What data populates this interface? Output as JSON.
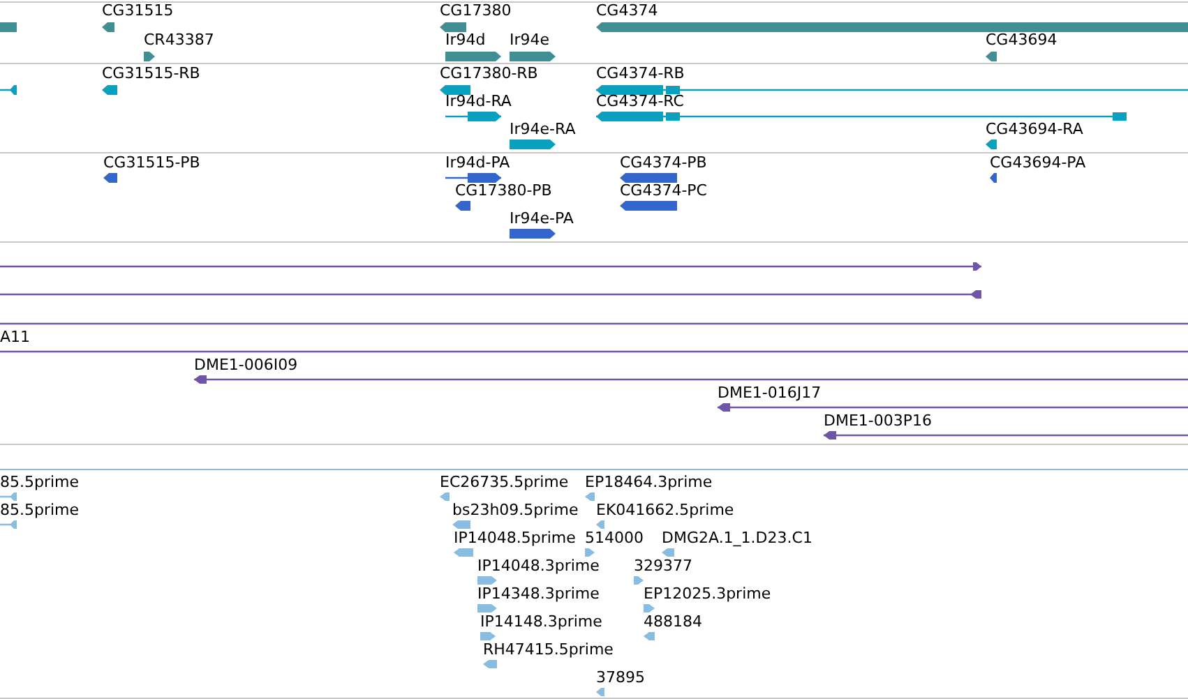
{
  "tracks": [
    {
      "features": [
        {
          "reverse": true
        },
        {
          "label": "CG31515",
          "reverse": true
        },
        {
          "label": "CR43387",
          "reverse": false
        },
        {
          "label": "CG17380",
          "reverse": true
        },
        {
          "label": "Ir94d",
          "reverse": false
        },
        {
          "label": "Ir94e",
          "reverse": false
        },
        {
          "label": "CG4374",
          "reverse": true
        },
        {
          "label": "CG43694",
          "reverse": true
        }
      ]
    },
    {
      "features": [
        {
          "reverse": true
        },
        {
          "label": "CG31515-RB",
          "reverse": true
        },
        {
          "label": "CG17380-RB",
          "reverse": true
        },
        {
          "label": "Ir94d-RA",
          "reverse": false
        },
        {
          "label": "Ir94e-RA",
          "reverse": false
        },
        {
          "label": "CG4374-RB",
          "reverse": true
        },
        {
          "label": "CG4374-RC",
          "reverse": true
        },
        {
          "label": "CG43694-RA",
          "reverse": true
        }
      ]
    },
    {
      "features": [
        {
          "label": "CG31515-PB",
          "reverse": true
        },
        {
          "label": "Ir94d-PA",
          "reverse": false
        },
        {
          "label": "CG17380-PB",
          "reverse": true
        },
        {
          "label": "Ir94e-PA",
          "reverse": false
        },
        {
          "label": "CG4374-PB",
          "reverse": true
        },
        {
          "label": "CG4374-PC",
          "reverse": true
        },
        {
          "label": "CG43694-PA",
          "reverse": true
        }
      ]
    },
    {
      "features": [
        {
          "kind": "arrow",
          "reverse": false
        },
        {
          "kind": "arrow",
          "reverse": true
        },
        {
          "kind": "line"
        },
        {
          "kind": "line",
          "label": "A11"
        },
        {
          "kind": "arrow",
          "label": "DME1-006I09",
          "reverse": true
        },
        {
          "kind": "arrow",
          "label": "DME1-016J17",
          "reverse": true
        },
        {
          "kind": "arrow",
          "label": "DME1-003P16",
          "reverse": true
        }
      ]
    },
    {
      "features": [
        {
          "label": "85.5prime",
          "reverse": true
        },
        {
          "label": "85.5prime",
          "reverse": true
        },
        {
          "label": "EC26735.5prime",
          "reverse": true
        },
        {
          "label": "EP18464.3prime",
          "reverse": true
        },
        {
          "label": "bs23h09.5prime",
          "reverse": true
        },
        {
          "label": "EK041662.5prime",
          "reverse": true
        },
        {
          "label": "IP14048.5prime",
          "reverse": true
        },
        {
          "label": "514000",
          "reverse": false
        },
        {
          "label": "DMG2A.1_1.D23.C1",
          "reverse": true
        },
        {
          "label": "IP14048.3prime",
          "reverse": false
        },
        {
          "label": "329377",
          "reverse": false
        },
        {
          "label": "IP14348.3prime",
          "reverse": false
        },
        {
          "label": "EP12025.3prime",
          "reverse": false
        },
        {
          "label": "IP14148.3prime",
          "reverse": false
        },
        {
          "label": "488184",
          "reverse": true
        },
        {
          "label": "RH47415.5prime",
          "reverse": true
        },
        {
          "label": "37895",
          "reverse": true
        }
      ]
    }
  ]
}
